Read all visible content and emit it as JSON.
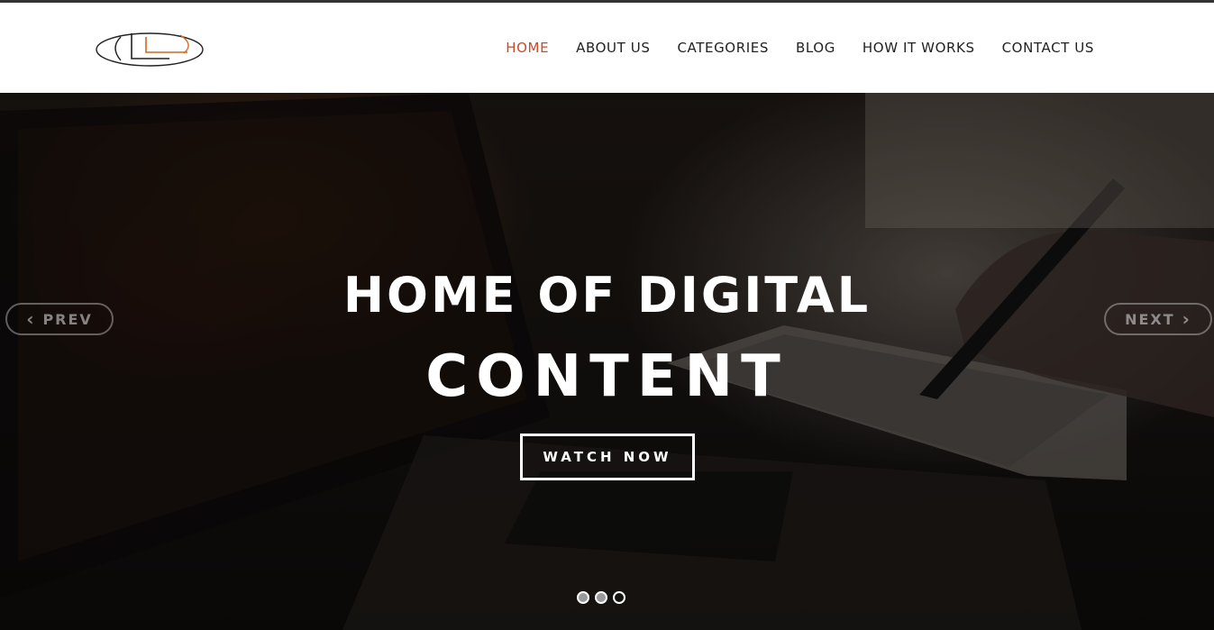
{
  "brand": {
    "logo_icon": "ll-monogram-logo",
    "colors": {
      "accent": "#c74a2a",
      "logo_orange": "#d2691e"
    }
  },
  "nav": {
    "items": [
      {
        "label": "HOME",
        "active": true
      },
      {
        "label": "ABOUT US"
      },
      {
        "label": "CATEGORIES"
      },
      {
        "label": "BLOG"
      },
      {
        "label": "HOW IT WORKS"
      },
      {
        "label": "CONTACT US"
      }
    ]
  },
  "hero": {
    "title_line1": "HOME OF DIGITAL",
    "title_line2": "CONTENT",
    "cta_label": "WATCH NOW",
    "prev_label": "PREV",
    "next_label": "NEXT",
    "prev_icon": "chevron-left-icon",
    "next_icon": "chevron-right-icon",
    "slides": 3,
    "active_slide": 3
  }
}
